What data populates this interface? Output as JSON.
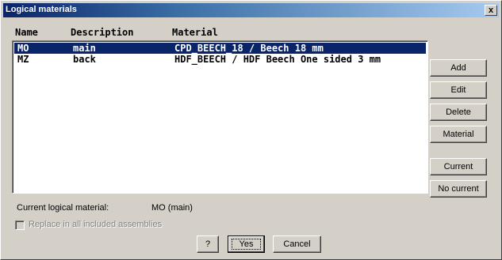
{
  "window": {
    "title": "Logical materials",
    "close_glyph": "x"
  },
  "list": {
    "columns": [
      "Name",
      "Description",
      "Material"
    ],
    "rows": [
      {
        "name": "MO",
        "description": "main",
        "material": "CPD_BEECH_18 / Beech 18 mm",
        "selected": true
      },
      {
        "name": "MZ",
        "description": "back",
        "material": "HDF_BEECH / HDF Beech One sided 3 mm",
        "selected": false
      }
    ]
  },
  "side_buttons": {
    "add": "Add",
    "edit": "Edit",
    "delete": "Delete",
    "material": "Material",
    "current": "Current",
    "no_current": "No current"
  },
  "status": {
    "current_label": "Current logical material:",
    "current_value": "MO (main)"
  },
  "options": {
    "replace_label": "Replace in all included assemblies",
    "replace_checked": false,
    "replace_enabled": false
  },
  "footer": {
    "help_label": "?",
    "yes_label": "Yes",
    "cancel_label": "Cancel"
  },
  "colors": {
    "selection": "#0a246a",
    "face": "#d4d0c8"
  }
}
